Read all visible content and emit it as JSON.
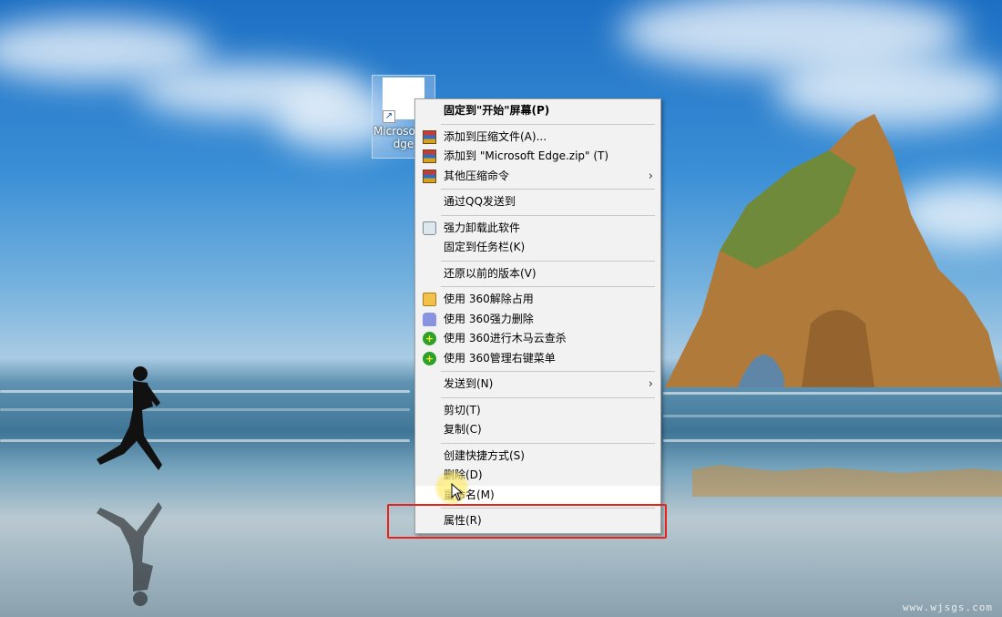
{
  "desktop": {
    "icon_label": "Microsoft Edge",
    "watermark": "www.wjsgs.com"
  },
  "context_menu": {
    "items": [
      {
        "label": "固定到\"开始\"屏幕(P)",
        "bold": true
      },
      {
        "label": "添加到压缩文件(A)...",
        "icon": "archive-icon"
      },
      {
        "label": "添加到 \"Microsoft Edge.zip\" (T)",
        "icon": "archive-icon"
      },
      {
        "label": "其他压缩命令",
        "icon": "archive-icon",
        "submenu": true
      },
      {
        "label": "通过QQ发送到"
      },
      {
        "label": "强力卸载此软件",
        "icon": "trash-icon"
      },
      {
        "label": "固定到任务栏(K)"
      },
      {
        "label": "还原以前的版本(V)"
      },
      {
        "label": "使用 360解除占用",
        "icon": "unlock-icon"
      },
      {
        "label": "使用 360强力删除",
        "icon": "shred-icon"
      },
      {
        "label": "使用 360进行木马云查杀",
        "icon": "360-guard-icon"
      },
      {
        "label": "使用 360管理右键菜单",
        "icon": "360-guard-icon"
      },
      {
        "label": "发送到(N)",
        "submenu": true
      },
      {
        "label": "剪切(T)"
      },
      {
        "label": "复制(C)"
      },
      {
        "label": "创建快捷方式(S)"
      },
      {
        "label": "删除(D)"
      },
      {
        "label": "重命名(M)",
        "hovered": true
      },
      {
        "label": "属性(R)"
      }
    ]
  },
  "colors": {
    "highlight_box": "#e8231a",
    "menu_background": "#f2f2f2"
  }
}
